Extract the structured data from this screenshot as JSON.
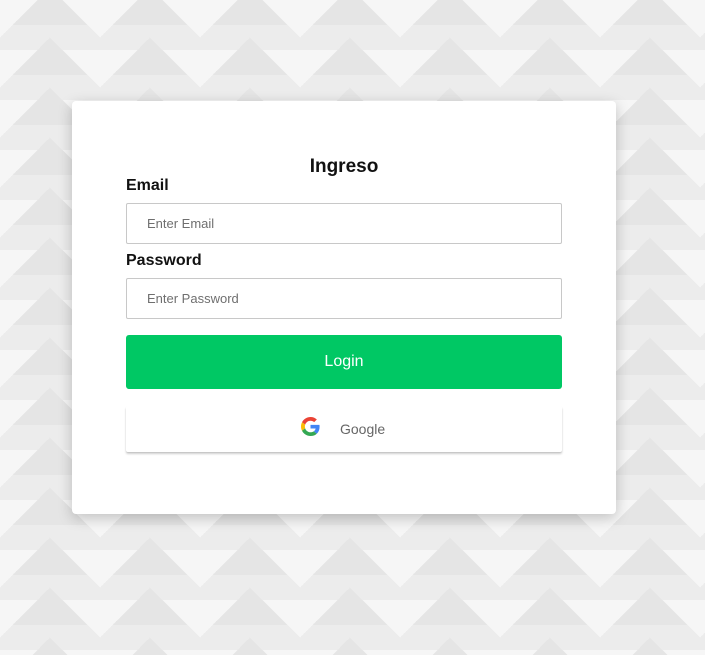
{
  "login_card": {
    "title": "Ingreso",
    "email": {
      "label": "Email",
      "placeholder": "Enter Email",
      "value": ""
    },
    "password": {
      "label": "Password",
      "placeholder": "Enter Password",
      "value": ""
    },
    "login_button": {
      "label": "Login",
      "color": "#00c864"
    },
    "google_button": {
      "label": "Google",
      "icon": "google-g-icon"
    }
  }
}
